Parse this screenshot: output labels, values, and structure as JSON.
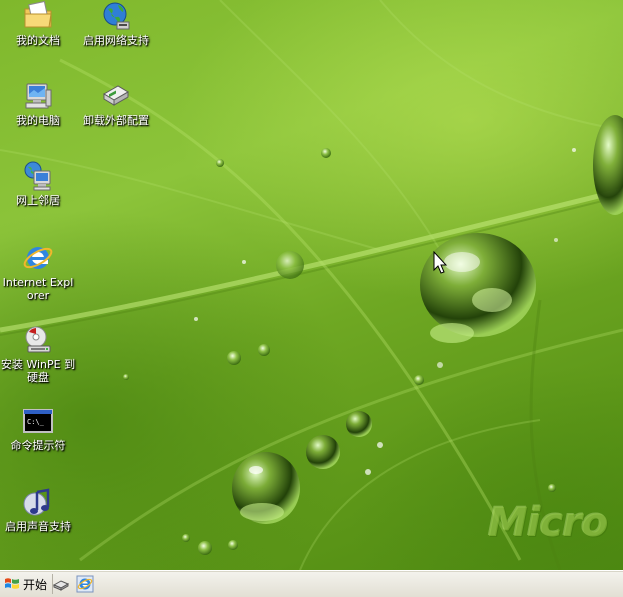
{
  "desktop": {
    "icons": [
      {
        "label": "我的文档",
        "icon": "my-documents-folder-icon"
      },
      {
        "label": "启用网络支持",
        "icon": "network-globe-icon"
      },
      {
        "label": "我的电脑",
        "icon": "my-computer-icon"
      },
      {
        "label": "卸载外部配置",
        "icon": "external-config-drive-icon"
      },
      {
        "label": "网上邻居",
        "icon": "network-neighborhood-icon"
      },
      {
        "label": "Internet Explorer",
        "icon": "internet-explorer-icon"
      },
      {
        "label": "安装 WinPE 到硬盘",
        "icon": "install-disc-icon"
      },
      {
        "label": "命令提示符",
        "icon": "command-prompt-icon"
      },
      {
        "label": "启用声音支持",
        "icon": "sound-music-note-icon"
      }
    ],
    "wallpaper_watermark": "Micro",
    "colors": {
      "leaf_green": "#7fb82c",
      "taskbar": "#ece9d8"
    }
  },
  "taskbar": {
    "start_label": "开始",
    "quick_launch": [
      "show-desktop-icon",
      "internet-explorer-icon"
    ]
  }
}
